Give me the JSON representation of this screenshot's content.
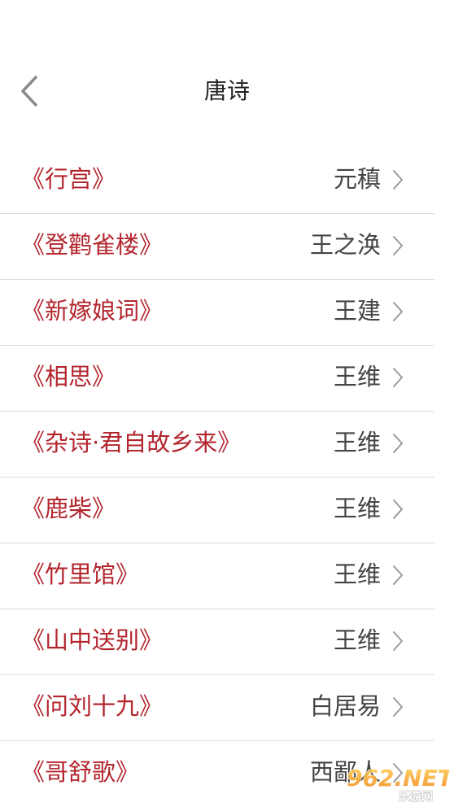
{
  "header": {
    "title": "唐诗"
  },
  "poems": [
    {
      "title": "《行宫》",
      "author": "元稹"
    },
    {
      "title": "《登鹳雀楼》",
      "author": "王之涣"
    },
    {
      "title": "《新嫁娘词》",
      "author": "王建"
    },
    {
      "title": "《相思》",
      "author": "王维"
    },
    {
      "title": "《杂诗·君自故乡来》",
      "author": "王维"
    },
    {
      "title": "《鹿柴》",
      "author": "王维"
    },
    {
      "title": "《竹里馆》",
      "author": "王维"
    },
    {
      "title": "《山中送别》",
      "author": "王维"
    },
    {
      "title": "《问刘十九》",
      "author": "白居易"
    },
    {
      "title": "《哥舒歌》",
      "author": "西鄙人"
    }
  ],
  "icons": {
    "back": "chevron-left-icon",
    "row_arrow": "chevron-right-icon"
  },
  "colors": {
    "title_red": "#b3262e",
    "author_gray": "#444444",
    "divider": "#dddddd"
  },
  "watermark": {
    "text": "962.NET",
    "subtext": "乐游网"
  }
}
